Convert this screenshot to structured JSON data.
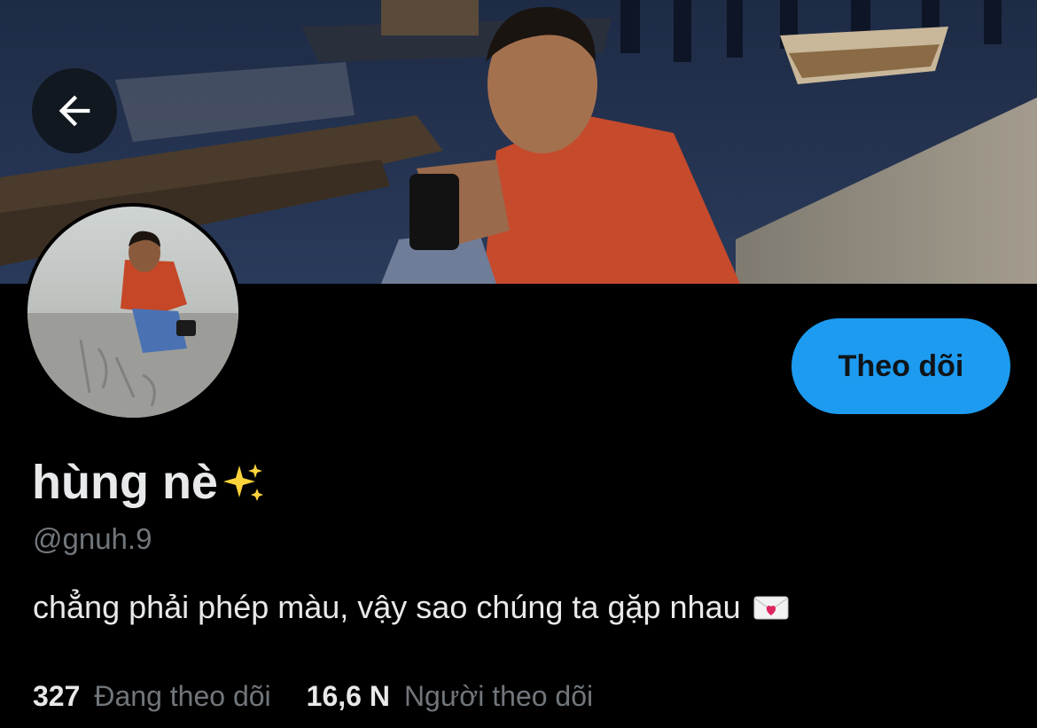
{
  "profile": {
    "display_name": "hùng nè",
    "handle": "@gnuh.9",
    "bio": "chẳng phải phép màu, vậy sao chúng ta gặp nhau",
    "follow_label": "Theo dõi"
  },
  "stats": {
    "following_count": "327",
    "following_label": "Đang theo dõi",
    "followers_count": "16,6 N",
    "followers_label": "Người theo dõi"
  },
  "icons": {
    "back": "arrow-left-icon",
    "name_emoji": "sparkles-icon",
    "bio_emoji": "love-letter-icon"
  },
  "colors": {
    "background": "#000000",
    "accent": "#1d9bf0",
    "primary_text": "#e7e9ea",
    "secondary_text": "#71767b"
  }
}
